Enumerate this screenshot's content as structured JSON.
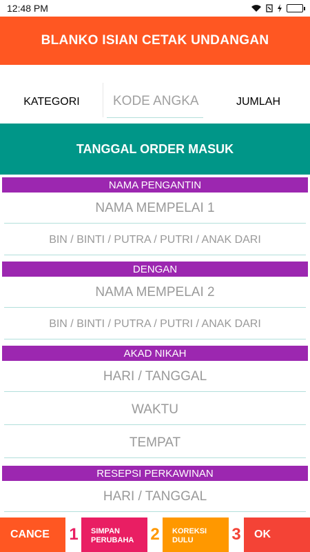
{
  "status": {
    "time": "12:48 PM"
  },
  "appbar": {
    "title": "BLANKO ISIAN CETAK UNDANGAN"
  },
  "row1": {
    "kategori": "KATEGORI",
    "kode_placeholder": "KODE ANGKA",
    "jumlah": "JUMLAH"
  },
  "tanggal_button": "TANGGAL ORDER MASUK",
  "sections": {
    "pengantin": "NAMA PENGANTIN",
    "dengan": "DENGAN",
    "akad": "AKAD NIKAH",
    "resepsi": "RESEPSI PERKAWINAN"
  },
  "fields": {
    "mempelai1": "NAMA MEMPELAI 1",
    "bin1": "BIN / BINTI / PUTRA / PUTRI / ANAK DARI",
    "mempelai2": "NAMA MEMPELAI 2",
    "bin2": "BIN / BINTI / PUTRA / PUTRI / ANAK DARI",
    "akad_hari": "HARI / TANGGAL",
    "akad_waktu": "WAKTU",
    "akad_tempat": "TEMPAT",
    "resepsi_hari": "HARI / TANGGAL"
  },
  "bottom": {
    "cancel": "CANCE",
    "n1": "1",
    "simpan": "SIMPAN PERUBAHA",
    "n2": "2",
    "koreksi": "KOREKSI DULU",
    "n3": "3",
    "ok": "OK"
  },
  "colors": {
    "appbar": "#ff5722",
    "teal": "#009688",
    "purple": "#9c27b0",
    "pink": "#e91e63",
    "orange": "#ff9800",
    "red": "#f44336"
  }
}
